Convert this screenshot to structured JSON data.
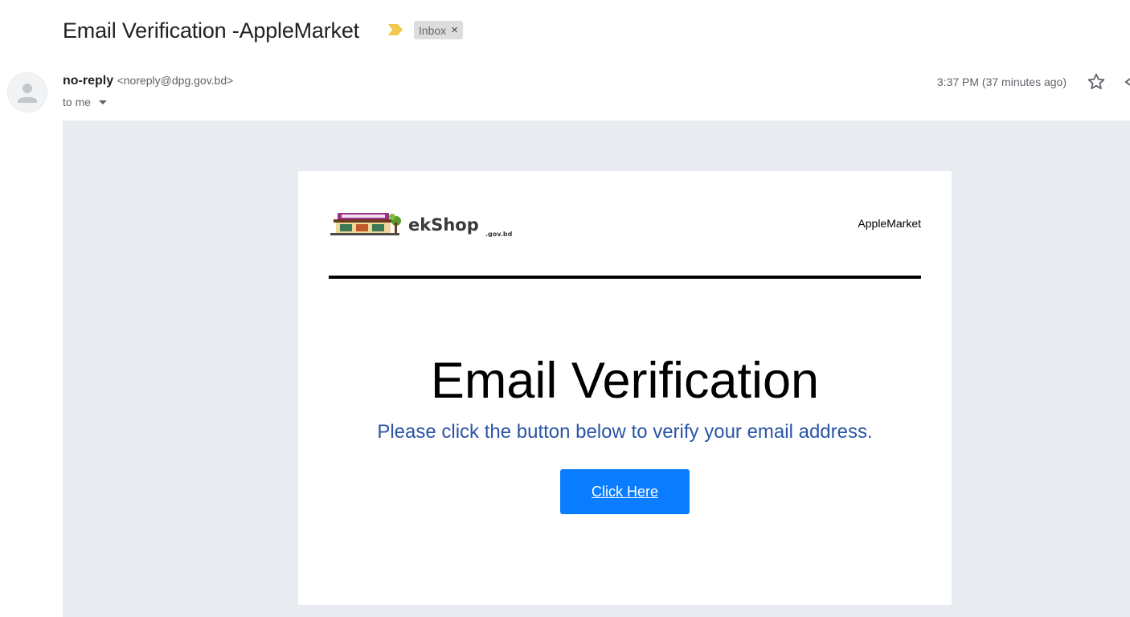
{
  "email": {
    "subject": "Email Verification -AppleMarket",
    "label": "Inbox",
    "label_close": "×",
    "sender_name": "no-reply",
    "sender_email": "<noreply@dpg.gov.bd>",
    "recipient": "to me",
    "timestamp": "3:37 PM (37 minutes ago)"
  },
  "body": {
    "logo_text": "ekShop",
    "logo_subtext": ".gov.bd",
    "shop_name": "AppleMarket",
    "heading": "Email Verification",
    "message": "Please click the button below to verify your email address.",
    "button_label": "Click Here"
  },
  "colors": {
    "importance_marker": "#f2c94c",
    "body_background": "#e8ebef",
    "subtitle_text": "#2a55a7",
    "button": "#0a7cff"
  },
  "icons": [
    "importance-marker-icon",
    "avatar-person-icon",
    "dropdown-caret-icon",
    "star-icon",
    "ekshop-logo"
  ]
}
